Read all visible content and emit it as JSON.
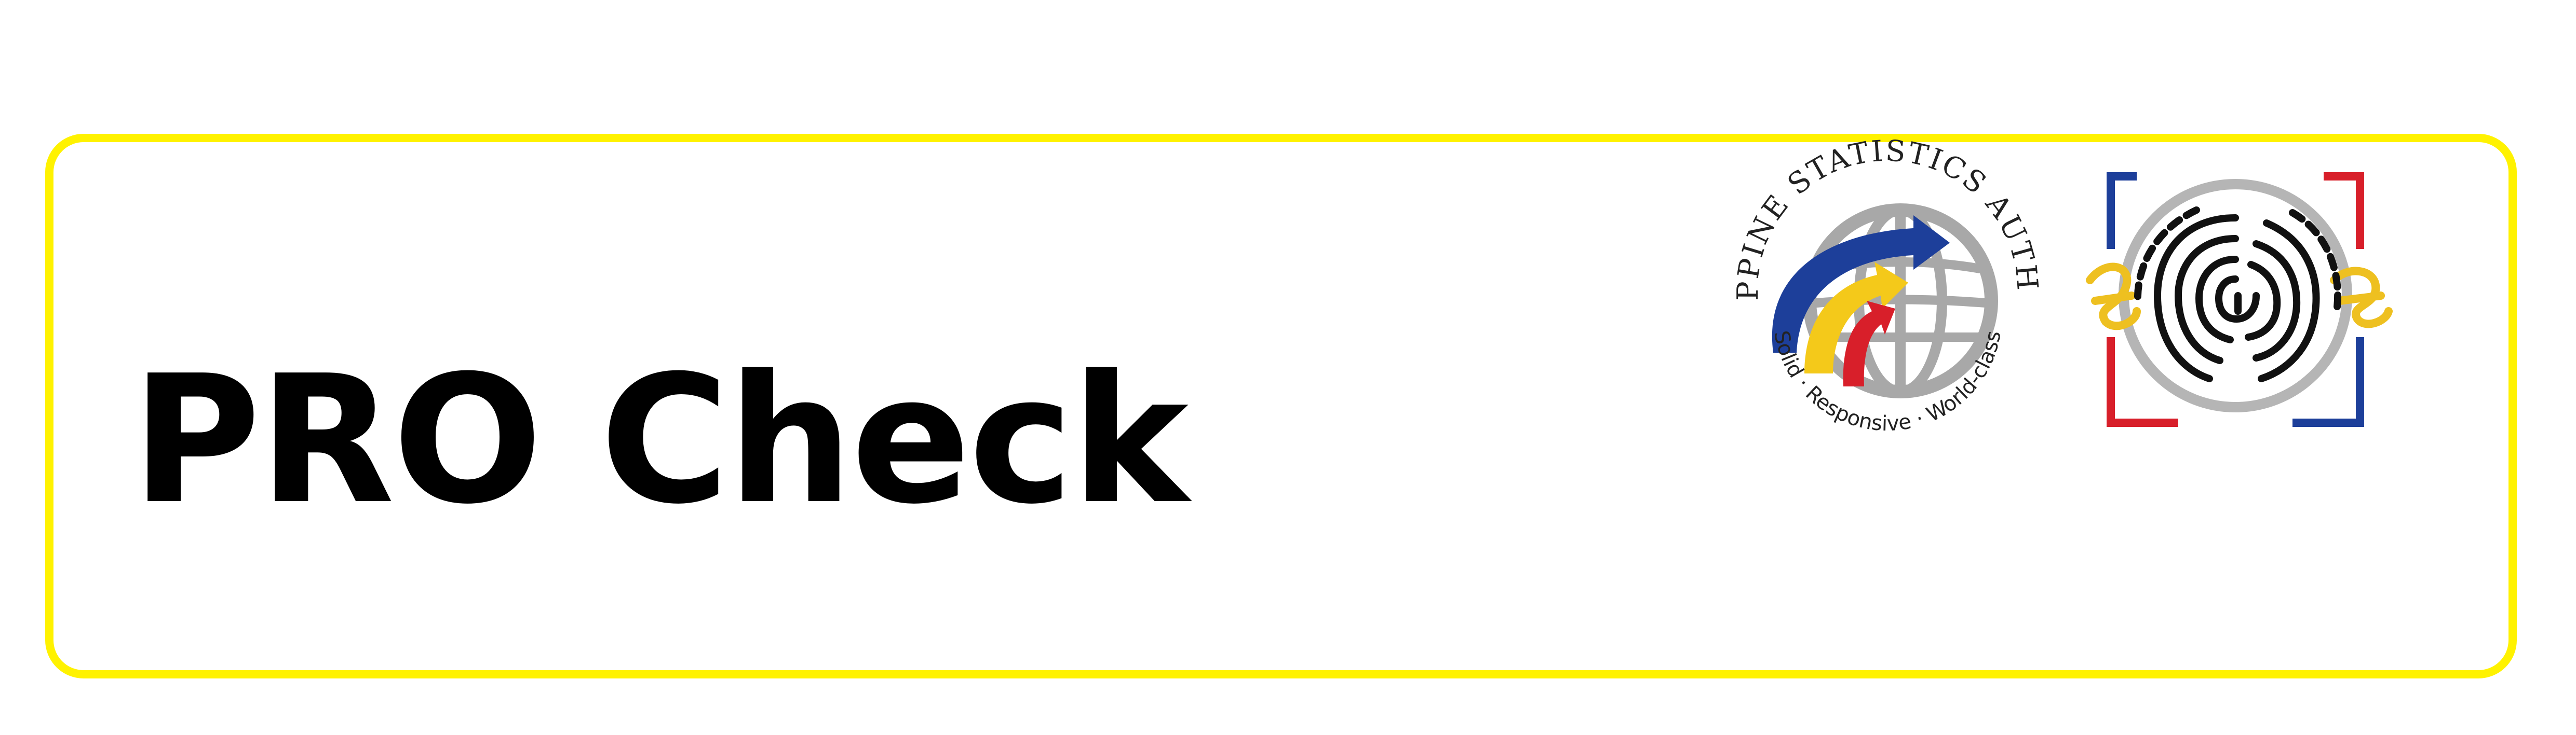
{
  "title": "PRO Check",
  "colors": {
    "frame": "#fff200",
    "title": "#000000",
    "psa_blue": "#1d3f9a",
    "psa_yellow": "#f4c91a",
    "psa_red": "#d81f2a",
    "globe_gray": "#a8a8a8",
    "fp_red": "#d81f2a",
    "fp_blue": "#1d3f9a",
    "fp_gold": "#eec020"
  },
  "psa_logo": {
    "arc_text": "PHILIPPINE STATISTICS AUTHORITY",
    "tagline": "Solid · Responsive · World-class",
    "icon": "psa-globe-logo"
  },
  "fingerprint_logo": {
    "icon": "fingerprint-id-logo"
  }
}
